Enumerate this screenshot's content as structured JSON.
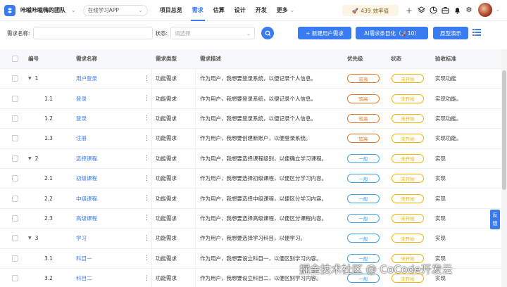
{
  "topbar": {
    "team_name": "咔嗞咔嗞嗨的团队",
    "project": "在线学习APP",
    "nav": [
      "项目总览",
      "需求",
      "估算",
      "设计",
      "开发",
      "更多"
    ],
    "active_nav": "需求",
    "efficiency_value": "439",
    "efficiency_label": "效率值"
  },
  "filter": {
    "name_label": "需求名称:",
    "name_value": "",
    "status_label": "状态:",
    "status_placeholder": "请选择",
    "new_button": "+ 新建用户需求",
    "ai_button": "AI需求条目化（🚀10）",
    "prototype_button": "原型演示"
  },
  "table": {
    "columns": [
      "编号",
      "需求名称",
      "需求类型",
      "需求描述",
      "优先级",
      "状态",
      "验收标准"
    ],
    "rows": [
      {
        "id": "1",
        "level": 0,
        "name": "用户登录",
        "type": "功能需求",
        "desc": "作为用户，我想要登录系统，以便记录个人信息。",
        "priority": "较高",
        "status": "未开始",
        "acceptance": "实现功能"
      },
      {
        "id": "1.1",
        "level": 1,
        "name": "登录",
        "type": "功能需求",
        "desc": "作为用户，我想要登录系统，以便记录个人信息。",
        "priority": "较高",
        "status": "未开始",
        "acceptance": "实现功能。"
      },
      {
        "id": "1.2",
        "level": 1,
        "name": "登录",
        "type": "功能需求",
        "desc": "作为用户，我想要登录系统，以便记录个人信息。",
        "priority": "较高",
        "status": "未开始",
        "acceptance": "实现功能。"
      },
      {
        "id": "1.3",
        "level": 1,
        "name": "注册",
        "type": "功能需求",
        "desc": "作为用户，我想要创建新账户，以便登录系统。",
        "priority": "较高",
        "status": "未开始",
        "acceptance": "实现功能。"
      },
      {
        "id": "2",
        "level": 0,
        "name": "选择课程",
        "type": "功能需求",
        "desc": "作为用户，我想要选择课程级别，以便确立学习课程。",
        "priority": "一般",
        "status": "未开始",
        "acceptance": "实现"
      },
      {
        "id": "2.1",
        "level": 1,
        "name": "初级课程",
        "type": "功能需求",
        "desc": "作为用户，我想要选择初级课程，以便区分学习内容。",
        "priority": "一般",
        "status": "未开始",
        "acceptance": "实现"
      },
      {
        "id": "2.2",
        "level": 1,
        "name": "中级课程",
        "type": "功能需求",
        "desc": "作为用户，我想要选择中级课程，以便区分学习内容。",
        "priority": "一般",
        "status": "未开始",
        "acceptance": "实现"
      },
      {
        "id": "2.3",
        "level": 1,
        "name": "高级课程",
        "type": "功能需求",
        "desc": "作为用户，我想要选择高级课程，以便区分课程内容。",
        "priority": "一般",
        "status": "未开始",
        "acceptance": "实现"
      },
      {
        "id": "3",
        "level": 0,
        "name": "学习",
        "type": "功能需求",
        "desc": "作为用户，我想要选择学习科目，以便学习。",
        "priority": "一般",
        "status": "未开始",
        "acceptance": "实现"
      },
      {
        "id": "3.1",
        "level": 1,
        "name": "科目一",
        "type": "功能需求",
        "desc": "作为用户，我想要设立科目一，以便区别学习内容。",
        "priority": "一般",
        "status": "未开始",
        "acceptance": "实现"
      },
      {
        "id": "3.2",
        "level": 1,
        "name": "科目二",
        "type": "功能需求",
        "desc": "作为用户，我想要设立科目二，以便区别学习内容。",
        "priority": "一般",
        "status": "未开始",
        "acceptance": "实现"
      }
    ]
  },
  "feedback": "反馈",
  "watermark": "掘金技术社区 @ CoCode开发云",
  "colors": {
    "primary": "#3a7cf0",
    "priority_high": "#e8731e",
    "priority_normal": "#3aa0e8",
    "status_not_started": "#f0b400"
  }
}
